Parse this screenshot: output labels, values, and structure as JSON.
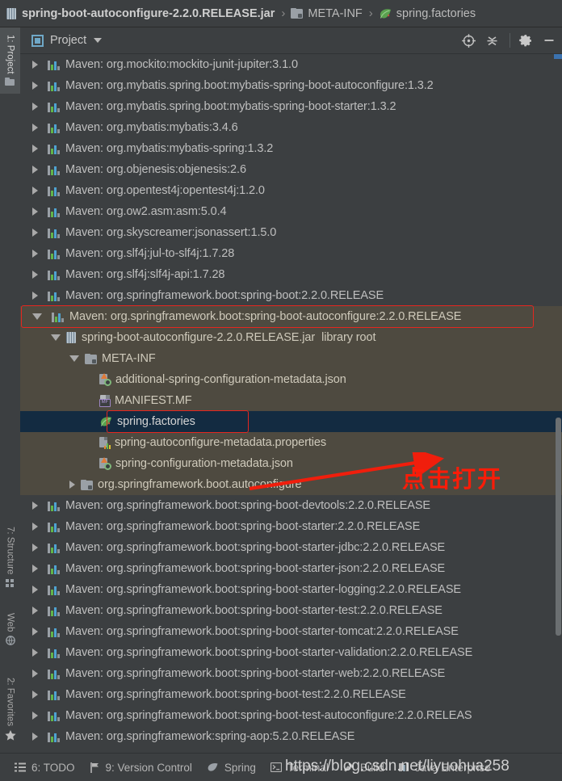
{
  "breadcrumb": {
    "separator": "›",
    "items": [
      {
        "label": "spring-boot-autoconfigure-2.2.0.RELEASE.jar",
        "icon": "jar-icon",
        "bold": true
      },
      {
        "label": "META-INF",
        "icon": "folder-icon",
        "bold": false
      },
      {
        "label": "spring.factories",
        "icon": "spring-leaf-icon",
        "bold": false
      }
    ]
  },
  "left_tool_strip": {
    "tabs": [
      {
        "label": "1: Project",
        "icon": "project-icon",
        "active": true
      },
      {
        "label": "7: Structure",
        "icon": "structure-icon",
        "active": false
      },
      {
        "label": "Web",
        "icon": "web-icon",
        "active": false
      },
      {
        "label": "2: Favorites",
        "icon": "star-icon",
        "active": false
      }
    ]
  },
  "panel_toolbar": {
    "title": "Project",
    "dropdown_icon": "chevron-down-icon",
    "view_icon": "project-view-icon",
    "buttons": [
      {
        "name": "locate-in-tree-button",
        "icon": "crosshair-icon"
      },
      {
        "name": "collapse-all-button",
        "icon": "collapse-all-icon"
      },
      {
        "name": "settings-button",
        "icon": "gear-icon"
      },
      {
        "name": "hide-panel-button",
        "icon": "minus-icon"
      }
    ]
  },
  "tree": {
    "rows": [
      {
        "label": "Maven: org.mockito:mockito-junit-jupiter:3.1.0",
        "icon": "maven-library-icon",
        "indent": 0,
        "state": "collapsed",
        "style": "normal"
      },
      {
        "label": "Maven: org.mybatis.spring.boot:mybatis-spring-boot-autoconfigure:1.3.2",
        "icon": "maven-library-icon",
        "indent": 0,
        "state": "collapsed",
        "style": "normal"
      },
      {
        "label": "Maven: org.mybatis.spring.boot:mybatis-spring-boot-starter:1.3.2",
        "icon": "maven-library-icon",
        "indent": 0,
        "state": "collapsed",
        "style": "normal"
      },
      {
        "label": "Maven: org.mybatis:mybatis:3.4.6",
        "icon": "maven-library-icon",
        "indent": 0,
        "state": "collapsed",
        "style": "normal"
      },
      {
        "label": "Maven: org.mybatis:mybatis-spring:1.3.2",
        "icon": "maven-library-icon",
        "indent": 0,
        "state": "collapsed",
        "style": "normal"
      },
      {
        "label": "Maven: org.objenesis:objenesis:2.6",
        "icon": "maven-library-icon",
        "indent": 0,
        "state": "collapsed",
        "style": "normal"
      },
      {
        "label": "Maven: org.opentest4j:opentest4j:1.2.0",
        "icon": "maven-library-icon",
        "indent": 0,
        "state": "collapsed",
        "style": "normal"
      },
      {
        "label": "Maven: org.ow2.asm:asm:5.0.4",
        "icon": "maven-library-icon",
        "indent": 0,
        "state": "collapsed",
        "style": "normal"
      },
      {
        "label": "Maven: org.skyscreamer:jsonassert:1.5.0",
        "icon": "maven-library-icon",
        "indent": 0,
        "state": "collapsed",
        "style": "normal"
      },
      {
        "label": "Maven: org.slf4j:jul-to-slf4j:1.7.28",
        "icon": "maven-library-icon",
        "indent": 0,
        "state": "collapsed",
        "style": "normal"
      },
      {
        "label": "Maven: org.slf4j:slf4j-api:1.7.28",
        "icon": "maven-library-icon",
        "indent": 0,
        "state": "collapsed",
        "style": "normal"
      },
      {
        "label": "Maven: org.springframework.boot:spring-boot:2.2.0.RELEASE",
        "icon": "maven-library-icon",
        "indent": 0,
        "state": "collapsed",
        "style": "normal"
      },
      {
        "label": "Maven: org.springframework.boot:spring-boot-autoconfigure:2.2.0.RELEASE",
        "icon": "maven-library-icon",
        "indent": 0,
        "state": "expanded",
        "style": "olive",
        "annotated": true
      },
      {
        "label": "spring-boot-autoconfigure-2.2.0.RELEASE.jar",
        "suffix": "library root",
        "icon": "jar-icon",
        "indent": 1,
        "state": "expanded",
        "style": "olive"
      },
      {
        "label": "META-INF",
        "icon": "folder-icon",
        "indent": 2,
        "state": "expanded",
        "style": "olive"
      },
      {
        "label": "additional-spring-configuration-metadata.json",
        "icon": "json-metadata-icon",
        "indent": 3,
        "state": "leaf",
        "style": "olive"
      },
      {
        "label": "MANIFEST.MF",
        "icon": "manifest-icon",
        "indent": 3,
        "state": "leaf",
        "style": "olive"
      },
      {
        "label": "spring.factories",
        "icon": "spring-leaf-icon",
        "indent": 3,
        "state": "leaf",
        "style": "selected",
        "annotated": true
      },
      {
        "label": "spring-autoconfigure-metadata.properties",
        "icon": "properties-icon",
        "indent": 3,
        "state": "leaf",
        "style": "olive"
      },
      {
        "label": "spring-configuration-metadata.json",
        "icon": "json-metadata-icon",
        "indent": 3,
        "state": "leaf",
        "style": "olive"
      },
      {
        "label": "org.springframework.boot.autoconfigure",
        "icon": "package-icon",
        "indent": 2,
        "state": "collapsed",
        "style": "olive"
      },
      {
        "label": "Maven: org.springframework.boot:spring-boot-devtools:2.2.0.RELEASE",
        "icon": "maven-library-icon",
        "indent": 0,
        "state": "collapsed",
        "style": "normal"
      },
      {
        "label": "Maven: org.springframework.boot:spring-boot-starter:2.2.0.RELEASE",
        "icon": "maven-library-icon",
        "indent": 0,
        "state": "collapsed",
        "style": "normal"
      },
      {
        "label": "Maven: org.springframework.boot:spring-boot-starter-jdbc:2.2.0.RELEASE",
        "icon": "maven-library-icon",
        "indent": 0,
        "state": "collapsed",
        "style": "normal"
      },
      {
        "label": "Maven: org.springframework.boot:spring-boot-starter-json:2.2.0.RELEASE",
        "icon": "maven-library-icon",
        "indent": 0,
        "state": "collapsed",
        "style": "normal"
      },
      {
        "label": "Maven: org.springframework.boot:spring-boot-starter-logging:2.2.0.RELEASE",
        "icon": "maven-library-icon",
        "indent": 0,
        "state": "collapsed",
        "style": "normal"
      },
      {
        "label": "Maven: org.springframework.boot:spring-boot-starter-test:2.2.0.RELEASE",
        "icon": "maven-library-icon",
        "indent": 0,
        "state": "collapsed",
        "style": "normal"
      },
      {
        "label": "Maven: org.springframework.boot:spring-boot-starter-tomcat:2.2.0.RELEASE",
        "icon": "maven-library-icon",
        "indent": 0,
        "state": "collapsed",
        "style": "normal"
      },
      {
        "label": "Maven: org.springframework.boot:spring-boot-starter-validation:2.2.0.RELEASE",
        "icon": "maven-library-icon",
        "indent": 0,
        "state": "collapsed",
        "style": "normal"
      },
      {
        "label": "Maven: org.springframework.boot:spring-boot-starter-web:2.2.0.RELEASE",
        "icon": "maven-library-icon",
        "indent": 0,
        "state": "collapsed",
        "style": "normal"
      },
      {
        "label": "Maven: org.springframework.boot:spring-boot-test:2.2.0.RELEASE",
        "icon": "maven-library-icon",
        "indent": 0,
        "state": "collapsed",
        "style": "normal"
      },
      {
        "label": "Maven: org.springframework.boot:spring-boot-test-autoconfigure:2.2.0.RELEAS",
        "icon": "maven-library-icon",
        "indent": 0,
        "state": "collapsed",
        "style": "normal"
      },
      {
        "label": "Maven: org.springframework:spring-aop:5.2.0.RELEASE",
        "icon": "maven-library-icon",
        "indent": 0,
        "state": "collapsed",
        "style": "normal"
      }
    ]
  },
  "annotation": {
    "note_text": "点击打开",
    "color": "#fb1c08",
    "arrow": "red-arrow"
  },
  "status_bar": {
    "items": [
      {
        "label": "6: TODO",
        "icon": "todo-list-icon",
        "mnemonic": "6"
      },
      {
        "label": "9: Version Control",
        "icon": "version-control-icon",
        "mnemonic": "9"
      },
      {
        "label": "Spring",
        "icon": "spring-leaf-icon",
        "mnemonic": ""
      },
      {
        "label": "Terminal",
        "icon": "terminal-icon",
        "mnemonic": ""
      },
      {
        "label": "Build",
        "icon": "build-hammer-icon",
        "mnemonic": ""
      },
      {
        "label": "Java Enterprise",
        "icon": "java-enterprise-icon",
        "mnemonic": ""
      }
    ]
  },
  "watermark": {
    "text": "https://blog.csdn.net/liyuohua258"
  },
  "colors": {
    "background": "#3c3f41",
    "expanded_row": "#4e4a40",
    "selected_row": "#132b41",
    "annotation_red": "#e5261f",
    "text": "#bfbfbf",
    "accent_blue": "#3b72af"
  }
}
